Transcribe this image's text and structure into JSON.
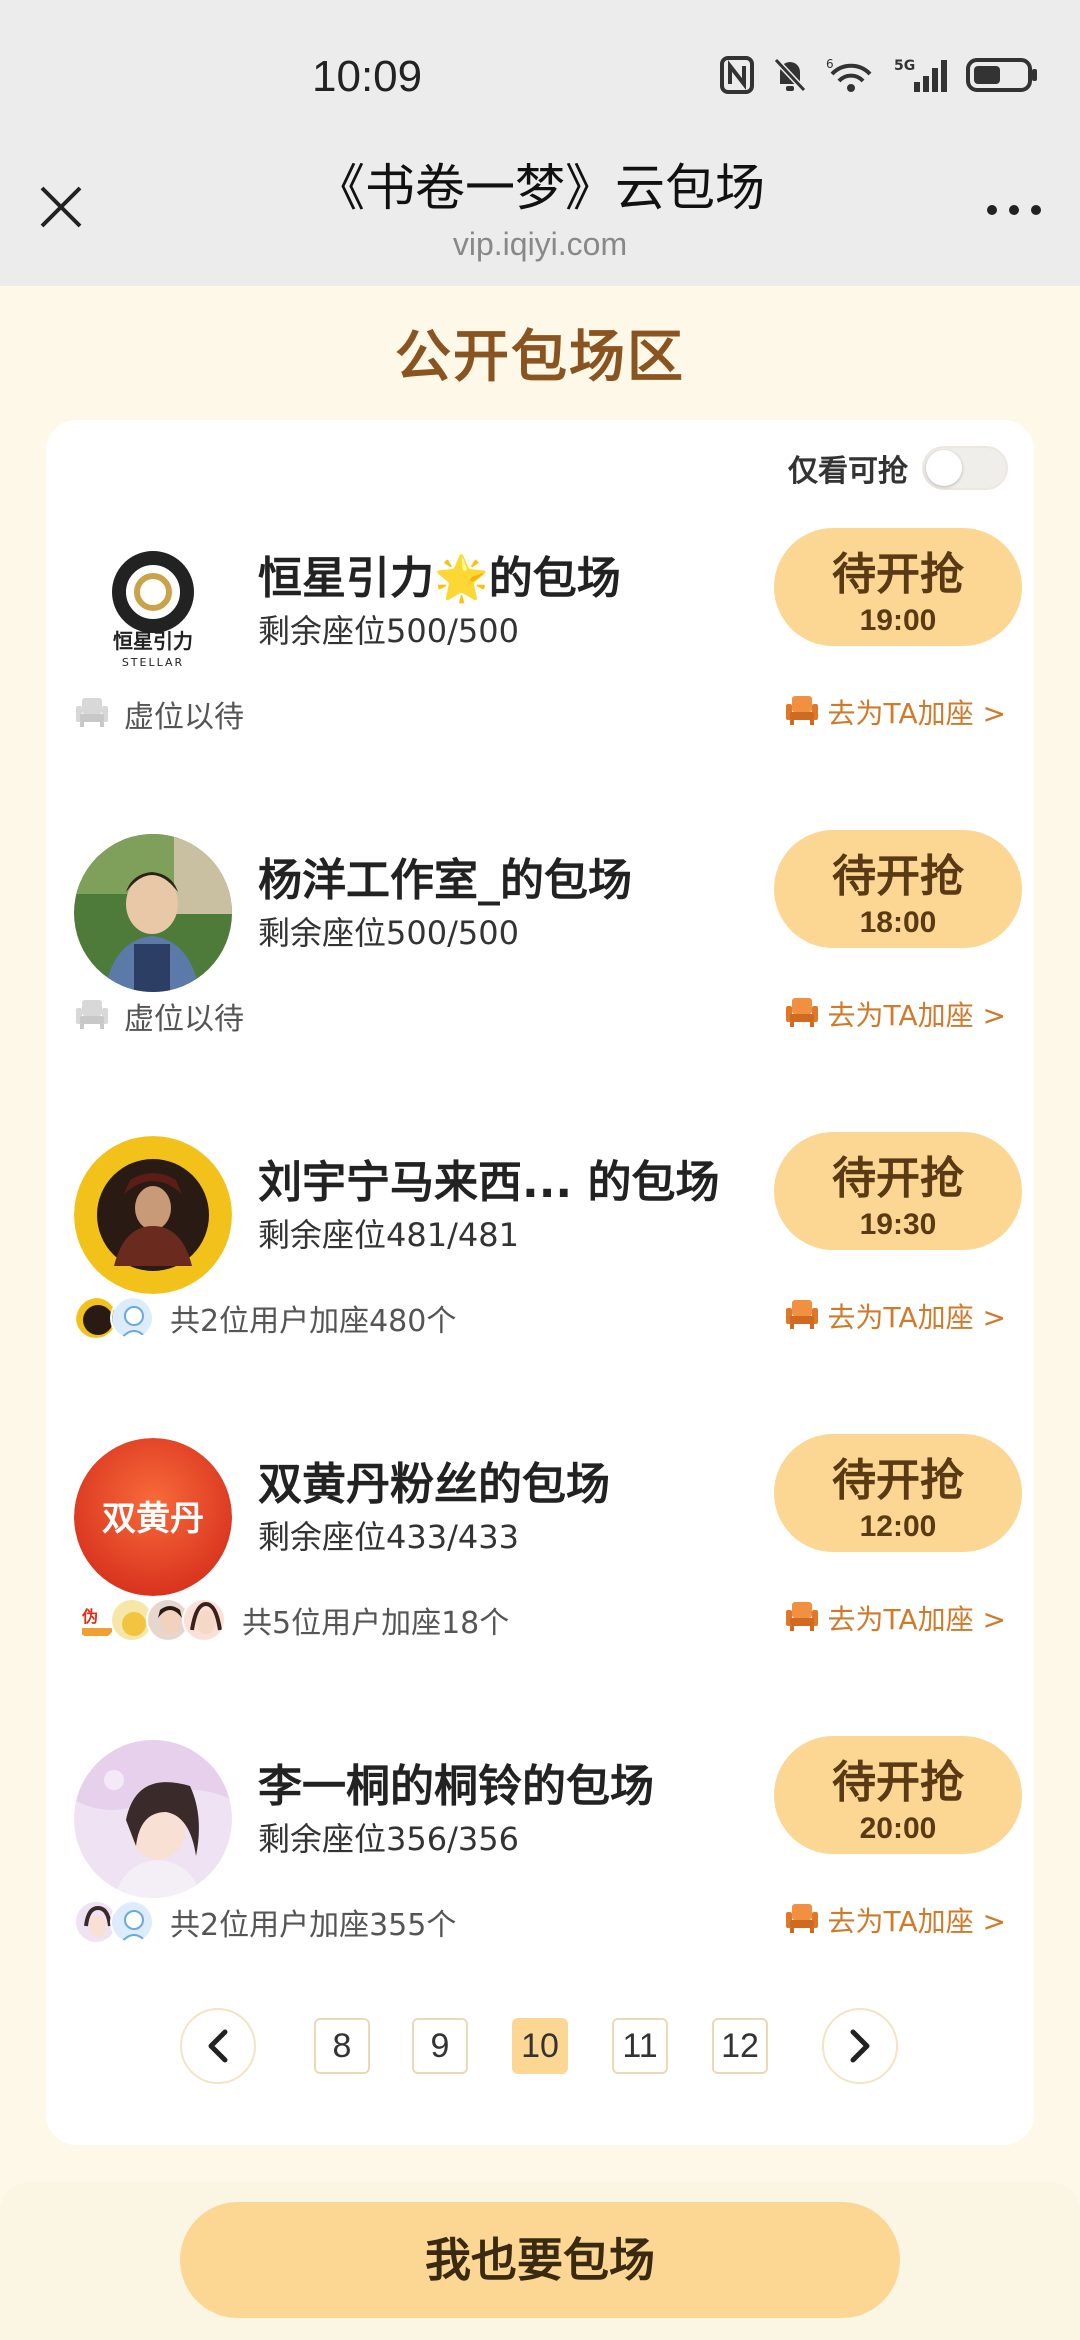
{
  "status_bar": {
    "time": "10:09",
    "icons": [
      "nfc-icon",
      "mute-icon",
      "wifi-icon",
      "signal-5g-icon",
      "battery-icon"
    ]
  },
  "browser": {
    "title": "《书卷一梦》云包场",
    "url": "vip.iqiyi.com"
  },
  "section_title": "公开包场区",
  "filter": {
    "label": "仅看可抢",
    "enabled": false
  },
  "sessions": [
    {
      "name": "恒星引力🌟的包场",
      "seats": "剩余座位500/500",
      "button_label": "待开抢",
      "button_time": "19:00",
      "join_text": "虚位以待",
      "action_text": "去为TA加座 >"
    },
    {
      "name": "杨洋工作室_的包场",
      "seats": "剩余座位500/500",
      "button_label": "待开抢",
      "button_time": "18:00",
      "join_text": "虚位以待",
      "action_text": "去为TA加座 >"
    },
    {
      "name": "刘宇宁马来西...   的包场",
      "seats": "剩余座位481/481",
      "button_label": "待开抢",
      "button_time": "19:30",
      "join_text": "共2位用户加座480个",
      "action_text": "去为TA加座 >"
    },
    {
      "name": "双黄丹粉丝的包场",
      "seats": "剩余座位433/433",
      "button_label": "待开抢",
      "button_time": "12:00",
      "join_text": "共5位用户加座18个",
      "action_text": "去为TA加座 >"
    },
    {
      "name": "李一桐的桐铃的包场",
      "seats": "剩余座位356/356",
      "button_label": "待开抢",
      "button_time": "20:00",
      "join_text": "共2位用户加座355个",
      "action_text": "去为TA加座 >"
    }
  ],
  "avatar_text": {
    "stellar_cn": "恒星引力",
    "stellar_en": "STELLAR",
    "shuanghuangdan": "双黄丹"
  },
  "pagination": {
    "pages": [
      "8",
      "9",
      "10",
      "11",
      "12"
    ],
    "current": "10"
  },
  "cta": "我也要包场",
  "colors": {
    "accent": "#fcd793",
    "accent_text": "#d07a2a",
    "section_title": "#8a5420",
    "background": "#fdf8e8"
  }
}
